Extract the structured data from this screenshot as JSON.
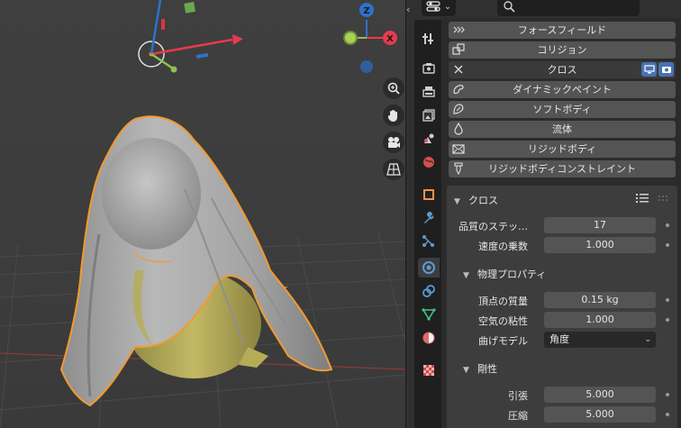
{
  "properties": {
    "physics_buttons": [
      {
        "label": "フォースフィールド",
        "icon": "force-field-icon"
      },
      {
        "label": "コリジョン",
        "icon": "collision-icon"
      },
      {
        "label": "クロス",
        "icon": "close-icon"
      },
      {
        "label": "ダイナミックペイント",
        "icon": "dynamic-paint-icon"
      },
      {
        "label": "ソフトボディ",
        "icon": "soft-body-icon"
      },
      {
        "label": "流体",
        "icon": "fluid-icon"
      },
      {
        "label": "リジッドボディ",
        "icon": "rigid-body-icon"
      },
      {
        "label": "リジッドボディコンストレイント",
        "icon": "rigid-body-constraint-icon"
      }
    ],
    "cloth_panel": {
      "title": "クロス",
      "quality_label": "品質のステッ…",
      "quality_value": "17",
      "speed_label": "速度の乗数",
      "speed_value": "1.000",
      "physical_title": "物理プロパティ",
      "mass_label": "頂点の質量",
      "mass_value": "0.15 kg",
      "air_label": "空気の粘性",
      "air_value": "1.000",
      "bending_label": "曲げモデル",
      "bending_value": "角度",
      "stiffness_title": "剛性",
      "tension_label": "引張",
      "tension_value": "5.000",
      "compression_label": "圧縮",
      "compression_value": "5.000"
    }
  },
  "viewport": {
    "gizmo_labels": {
      "z": "Z",
      "x": "X"
    },
    "colors": {
      "x_axis": "#e83a4d",
      "y_axis": "#8bc34a",
      "z_axis": "#2e72c9",
      "selection_outline": "#f29a2e",
      "cloth": "#a9a9a9",
      "body": "#b5ac55"
    }
  },
  "tabs": [
    {
      "icon": "tool-icon"
    },
    {
      "icon": "render-icon"
    },
    {
      "icon": "output-icon"
    },
    {
      "icon": "view-layer-icon"
    },
    {
      "icon": "scene-icon"
    },
    {
      "icon": "world-icon"
    },
    {
      "icon": "object-icon"
    },
    {
      "icon": "modifier-icon"
    },
    {
      "icon": "particles-icon"
    },
    {
      "icon": "physics-icon",
      "active": true
    },
    {
      "icon": "constraints-icon"
    },
    {
      "icon": "data-icon"
    },
    {
      "icon": "material-icon"
    },
    {
      "icon": "texture-icon"
    }
  ]
}
